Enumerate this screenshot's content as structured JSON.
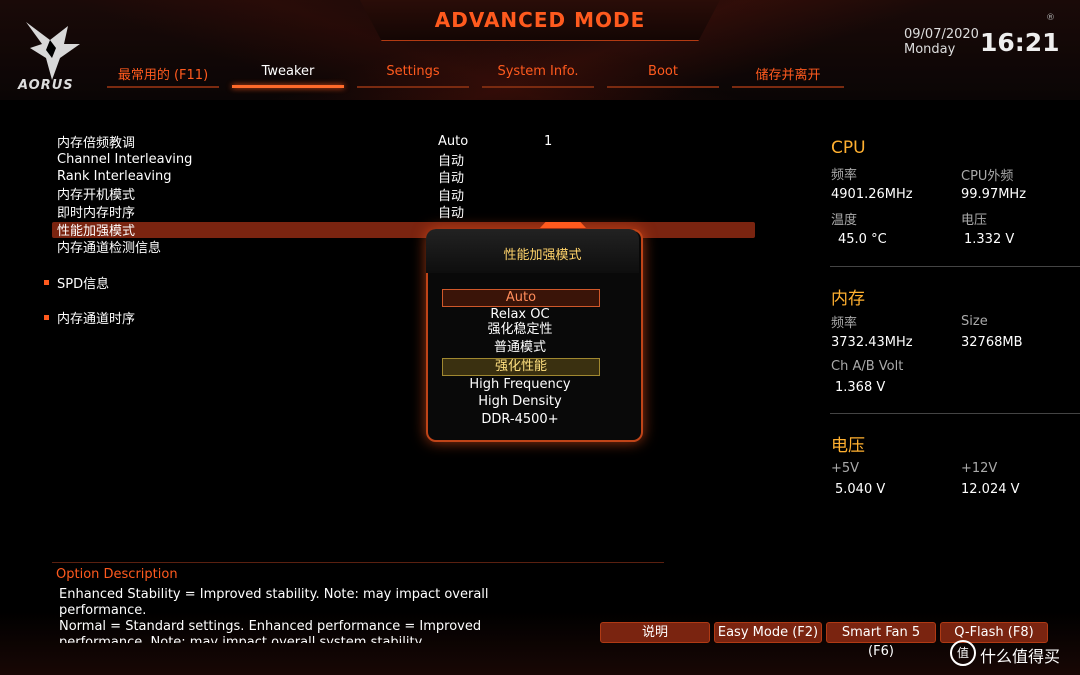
{
  "header": {
    "mode_title": "ADVANCED MODE",
    "logo_text": "AORUS",
    "date": "09/07/2020",
    "weekday": "Monday",
    "time": "16:21",
    "reg_mark": "®"
  },
  "tabs": [
    {
      "label": "最常用的 (F11)"
    },
    {
      "label": "Tweaker"
    },
    {
      "label": "Settings"
    },
    {
      "label": "System Info."
    },
    {
      "label": "Boot"
    },
    {
      "label": "储存并离开"
    }
  ],
  "settings": {
    "rows": [
      {
        "label": "内存倍频教调",
        "value": "Auto",
        "extra": "1"
      },
      {
        "label": "Channel Interleaving",
        "value": "自动"
      },
      {
        "label": "Rank Interleaving",
        "value": "自动"
      },
      {
        "label": "内存开机模式",
        "value": "自动"
      },
      {
        "label": "即时内存时序",
        "value": "自动"
      },
      {
        "label": "性能加强模式",
        "value": ""
      },
      {
        "label": "内存通道检测信息",
        "value": ""
      }
    ],
    "spd": "SPD信息",
    "channel_timing": "内存通道时序"
  },
  "popup": {
    "title": "性能加强模式",
    "options": [
      "Auto",
      "Relax OC",
      "强化稳定性",
      "普通模式",
      "强化性能",
      "High Frequency",
      "High Density",
      "DDR-4500+"
    ]
  },
  "right_panel": {
    "cpu": {
      "title": "CPU",
      "freq_label": "频率",
      "freq": "4901.26MHz",
      "ext_label": "CPU外频",
      "ext": "99.97MHz",
      "temp_label": "温度",
      "temp": "45.0 °C",
      "volt_label": "电压",
      "volt": "1.332 V"
    },
    "memory": {
      "title": "内存",
      "freq_label": "频率",
      "freq": "3732.43MHz",
      "size_label": "Size",
      "size": "32768MB",
      "volt_label": "Ch A/B Volt",
      "volt": "1.368 V"
    },
    "voltage": {
      "title": "电压",
      "v5_label": "+5V",
      "v5": "5.040 V",
      "v12_label": "+12V",
      "v12": "12.024 V"
    }
  },
  "description": {
    "title": "Option Description",
    "lines": [
      "Enhanced Stability = Improved stability. Note: may impact overall",
      "performance.",
      "Normal = Standard settings. Enhanced performance = Improved",
      "performance. Note: may impact overall system stability"
    ]
  },
  "footer_buttons": [
    {
      "label": "说明"
    },
    {
      "label": "Easy Mode (F2)"
    },
    {
      "label": "Smart Fan 5 (F6)"
    },
    {
      "label": "Q-Flash (F8)"
    }
  ],
  "watermark": {
    "text": "什么值得买",
    "icon": "值"
  },
  "colors": {
    "accent": "#ff5a1e",
    "highlight_row": "#7a2410",
    "info_title": "#ffb030"
  }
}
